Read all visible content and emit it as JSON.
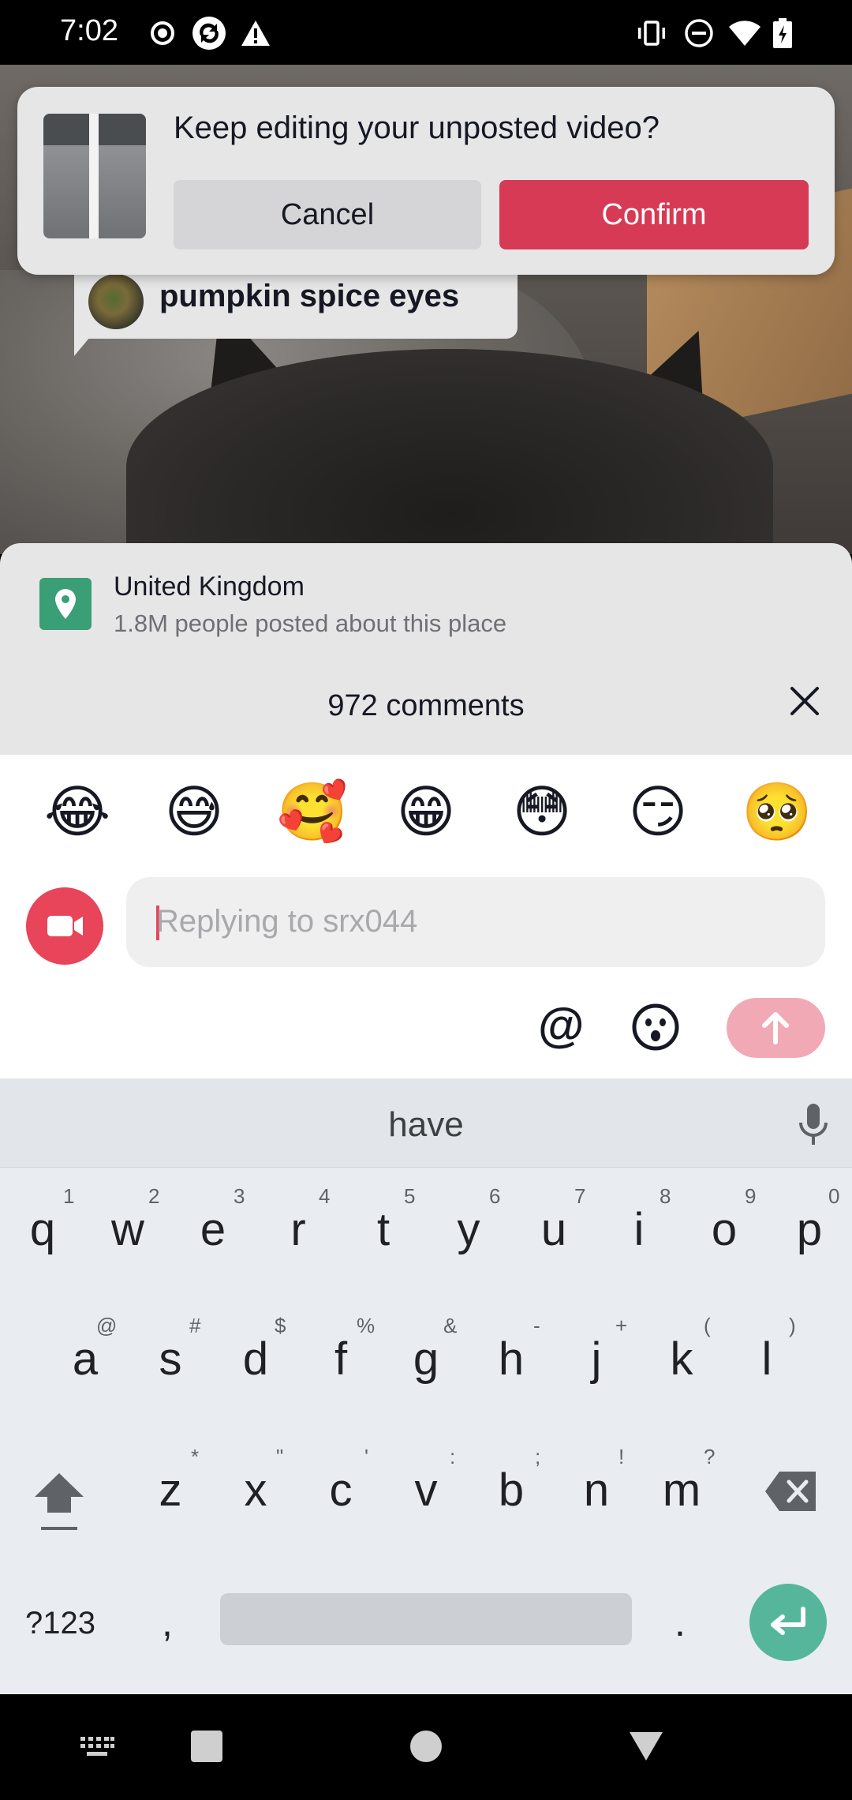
{
  "status_bar": {
    "time": "7:02",
    "icons_left": [
      "record-icon",
      "sync-icon",
      "warning-icon"
    ],
    "icons_right": [
      "vibrate-icon",
      "do-not-disturb-icon",
      "wifi-icon",
      "battery-icon"
    ]
  },
  "dialog": {
    "title": "Keep editing your unposted video?",
    "cancel_label": "Cancel",
    "confirm_label": "Confirm"
  },
  "sticker": {
    "name": "pumpkin spice eyes"
  },
  "location": {
    "title": "United Kingdom",
    "subtitle": "1.8M people posted about this place"
  },
  "comments": {
    "count_label": "972 comments"
  },
  "emoji_bar": [
    "😂",
    "😅",
    "🥰",
    "😁",
    "😳",
    "😏",
    "🥺"
  ],
  "reply": {
    "placeholder": "Replying to srx044",
    "at_symbol": "@"
  },
  "keyboard": {
    "suggestion": "have",
    "row1": [
      {
        "key": "q",
        "hint": "1"
      },
      {
        "key": "w",
        "hint": "2"
      },
      {
        "key": "e",
        "hint": "3"
      },
      {
        "key": "r",
        "hint": "4"
      },
      {
        "key": "t",
        "hint": "5"
      },
      {
        "key": "y",
        "hint": "6"
      },
      {
        "key": "u",
        "hint": "7"
      },
      {
        "key": "i",
        "hint": "8"
      },
      {
        "key": "o",
        "hint": "9"
      },
      {
        "key": "p",
        "hint": "0"
      }
    ],
    "row2": [
      {
        "key": "a",
        "hint": "@"
      },
      {
        "key": "s",
        "hint": "#"
      },
      {
        "key": "d",
        "hint": "$"
      },
      {
        "key": "f",
        "hint": "%"
      },
      {
        "key": "g",
        "hint": "&"
      },
      {
        "key": "h",
        "hint": "-"
      },
      {
        "key": "j",
        "hint": "+"
      },
      {
        "key": "k",
        "hint": "("
      },
      {
        "key": "l",
        "hint": ")"
      }
    ],
    "row3": [
      {
        "key": "z",
        "hint": "*"
      },
      {
        "key": "x",
        "hint": "\""
      },
      {
        "key": "c",
        "hint": "'"
      },
      {
        "key": "v",
        "hint": ":"
      },
      {
        "key": "b",
        "hint": ";"
      },
      {
        "key": "n",
        "hint": "!"
      },
      {
        "key": "m",
        "hint": "?"
      }
    ],
    "symbols_label": "?123",
    "comma": ",",
    "period": "."
  },
  "colors": {
    "accent": "#d63a55",
    "send_disabled": "#f2a9b6",
    "location_green": "#3a9e76",
    "enter_key": "#56b69c"
  }
}
